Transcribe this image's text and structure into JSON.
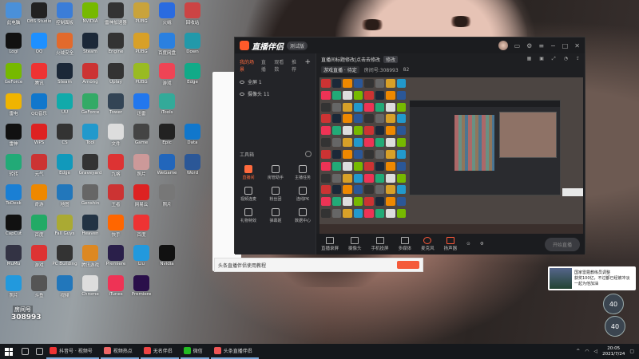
{
  "desktop": {
    "icons": [
      {
        "label": "此电脑",
        "color": "#4a90d9"
      },
      {
        "label": "OBS Studio",
        "color": "#222"
      },
      {
        "label": "控制面板",
        "color": "#3b7dd8"
      },
      {
        "label": "NVIDIA",
        "color": "#76b900"
      },
      {
        "label": "雷神加速器",
        "color": "#333"
      },
      {
        "label": "PUBG",
        "color": "#c9a33b"
      },
      {
        "label": "火绒",
        "color": "#2a6be0"
      },
      {
        "label": "回收站",
        "color": "#c44"
      },
      {
        "label": "Logi",
        "color": "#111"
      },
      {
        "label": "QQ",
        "color": "#1e90ff"
      },
      {
        "label": "火绒安全",
        "color": "#e26a2c"
      },
      {
        "label": "Steam",
        "color": "#1b2838"
      },
      {
        "label": "Engine",
        "color": "#333"
      },
      {
        "label": "PUBG",
        "color": "#d8a028"
      },
      {
        "label": "百度网盘",
        "color": "#2a80e0"
      },
      {
        "label": "Down",
        "color": "#29a"
      },
      {
        "label": "GeForce",
        "color": "#76b900"
      },
      {
        "label": "腾讯",
        "color": "#e33"
      },
      {
        "label": "Steam",
        "color": "#1b2838"
      },
      {
        "label": "Among",
        "color": "#c33"
      },
      {
        "label": "Uplay",
        "color": "#333"
      },
      {
        "label": "PUBG",
        "color": "#9b2"
      },
      {
        "label": "游戏",
        "color": "#e45"
      },
      {
        "label": "Edge",
        "color": "#1a8"
      },
      {
        "label": "雷电",
        "color": "#f0b400"
      },
      {
        "label": "QQ音乐",
        "color": "#17c"
      },
      {
        "label": "UU",
        "color": "#1aa"
      },
      {
        "label": "GeForce",
        "color": "#3a6"
      },
      {
        "label": "Tower",
        "color": "#345"
      },
      {
        "label": "迅雷",
        "color": "#27e"
      },
      {
        "label": "iTools",
        "color": "#3a9"
      },
      {
        "label": "雷神",
        "color": "#111"
      },
      {
        "label": "WPS",
        "color": "#d22"
      },
      {
        "label": "CS",
        "color": "#333"
      },
      {
        "label": "Tool",
        "color": "#29c"
      },
      {
        "label": "文件",
        "color": "#ddd"
      },
      {
        "label": "Game",
        "color": "#444"
      },
      {
        "label": "Epic",
        "color": "#222"
      },
      {
        "label": "Data",
        "color": "#17c"
      },
      {
        "label": "转转",
        "color": "#2a7"
      },
      {
        "label": "元气",
        "color": "#c33"
      },
      {
        "label": "Edge",
        "color": "#19b"
      },
      {
        "label": "Graveyard",
        "color": "#333"
      },
      {
        "label": "九格",
        "color": "#d33"
      },
      {
        "label": "照片",
        "color": "#c99"
      },
      {
        "label": "WeGame",
        "color": "#26b"
      },
      {
        "label": "Word",
        "color": "#2b5797"
      },
      {
        "label": "ToDesk",
        "color": "#1a7fd4"
      },
      {
        "label": "奇游",
        "color": "#e80"
      },
      {
        "label": "地图",
        "color": "#27b"
      },
      {
        "label": "Genshin",
        "color": "#666"
      },
      {
        "label": "王者",
        "color": "#c33"
      },
      {
        "label": "网易云",
        "color": "#d22"
      },
      {
        "label": "照片",
        "color": "#777"
      },
      {
        "label": "CapCut",
        "color": "#111"
      },
      {
        "label": "百度",
        "color": "#2a6"
      },
      {
        "label": "Fall Guys",
        "color": "#aa3"
      },
      {
        "label": "Heaven",
        "color": "#234"
      },
      {
        "label": "快手",
        "color": "#f60"
      },
      {
        "label": "百度",
        "color": "#e33"
      },
      {
        "label": "MuMu",
        "color": "#334"
      },
      {
        "label": "游戏",
        "color": "#d33"
      },
      {
        "label": "PC Building",
        "color": "#333"
      },
      {
        "label": "腾讯游戏",
        "color": "#d82"
      },
      {
        "label": "Premiere",
        "color": "#2a1f4a"
      },
      {
        "label": "Liu",
        "color": "#29d"
      },
      {
        "label": "Nvidia",
        "color": "#111"
      },
      {
        "label": "照片",
        "color": "#29d"
      },
      {
        "label": "斗鱼",
        "color": "#555"
      },
      {
        "label": "视频",
        "color": "#27b"
      },
      {
        "label": "Chrome",
        "color": "#ddd"
      },
      {
        "label": "iTunes",
        "color": "#e35"
      },
      {
        "label": "Premiere",
        "color": "#2a0f4a"
      }
    ]
  },
  "main_window": {
    "title": "直播伴侣",
    "badge": "测试版",
    "left_tabs": [
      "我的场景",
      "直播",
      "观看数",
      "推荐"
    ],
    "scenes": [
      {
        "label": "全屏 1"
      },
      {
        "label": "摄像头 11"
      }
    ],
    "tool_header": "工具箱",
    "tools": [
      {
        "label": "直播间",
        "active": true
      },
      {
        "label": "房管助手",
        "active": false
      },
      {
        "label": "主播任务",
        "active": false
      },
      {
        "label": "视频连麦",
        "active": false
      },
      {
        "label": "粉丝团",
        "active": false
      },
      {
        "label": "连线PK",
        "active": false
      },
      {
        "label": "礼物特效",
        "active": false
      },
      {
        "label": "弹幕姬",
        "active": false
      },
      {
        "label": "数据中心",
        "active": false
      }
    ],
    "info_line1": "直播间标题修改|点击去修改",
    "info_tag": "修改",
    "info_line2_tag": "游戏直播 · 待定",
    "info_line2_room": "房间号:308993",
    "info_line2_fans": "82",
    "bottom_tools": [
      {
        "label": "直播录屏",
        "cls": ""
      },
      {
        "label": "摄像头",
        "cls": ""
      },
      {
        "label": "手机投屏",
        "cls": ""
      },
      {
        "label": "多媒体",
        "cls": ""
      },
      {
        "label": "麦克风",
        "cls": "mic"
      },
      {
        "label": "扬声器",
        "cls": "spk"
      }
    ],
    "start_button": "开始直播"
  },
  "white_app_bar": "头条直播伴侣使用教程",
  "news": {
    "headline": "国家雷霆教练员调整",
    "line2": "获奖100亿，不过都已经被冲淡",
    "line3": "一起为他加油"
  },
  "circles": [
    "40",
    "40"
  ],
  "room": {
    "tag": "房间号",
    "number": "308993"
  },
  "taskbar": {
    "apps": [
      {
        "label": "抖音号 · 视频号",
        "color": "#e33"
      },
      {
        "label": "视频热点",
        "color": "#e66"
      },
      {
        "label": "无名伴侣",
        "color": "#e44"
      },
      {
        "label": "微信",
        "color": "#2b2"
      },
      {
        "label": "头条直播伴侣",
        "color": "#e55"
      }
    ],
    "time": "20:05",
    "date": "2021/7/24"
  }
}
